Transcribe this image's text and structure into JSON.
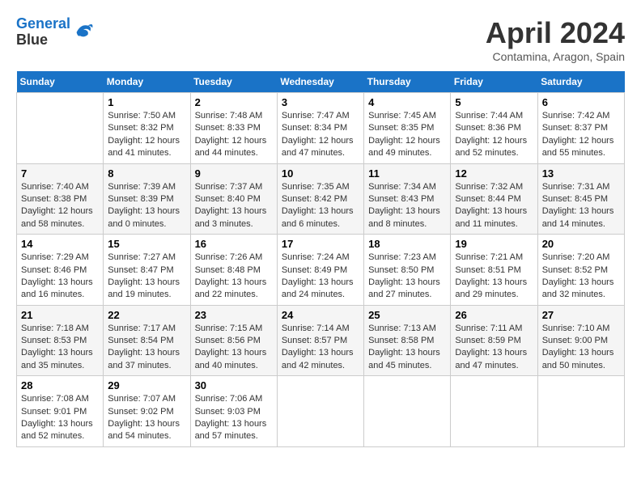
{
  "logo": {
    "line1": "General",
    "line2": "Blue"
  },
  "title": "April 2024",
  "location": "Contamina, Aragon, Spain",
  "days_of_week": [
    "Sunday",
    "Monday",
    "Tuesday",
    "Wednesday",
    "Thursday",
    "Friday",
    "Saturday"
  ],
  "weeks": [
    [
      {
        "day": "",
        "sunrise": "",
        "sunset": "",
        "daylight": ""
      },
      {
        "day": "1",
        "sunrise": "Sunrise: 7:50 AM",
        "sunset": "Sunset: 8:32 PM",
        "daylight": "Daylight: 12 hours and 41 minutes."
      },
      {
        "day": "2",
        "sunrise": "Sunrise: 7:48 AM",
        "sunset": "Sunset: 8:33 PM",
        "daylight": "Daylight: 12 hours and 44 minutes."
      },
      {
        "day": "3",
        "sunrise": "Sunrise: 7:47 AM",
        "sunset": "Sunset: 8:34 PM",
        "daylight": "Daylight: 12 hours and 47 minutes."
      },
      {
        "day": "4",
        "sunrise": "Sunrise: 7:45 AM",
        "sunset": "Sunset: 8:35 PM",
        "daylight": "Daylight: 12 hours and 49 minutes."
      },
      {
        "day": "5",
        "sunrise": "Sunrise: 7:44 AM",
        "sunset": "Sunset: 8:36 PM",
        "daylight": "Daylight: 12 hours and 52 minutes."
      },
      {
        "day": "6",
        "sunrise": "Sunrise: 7:42 AM",
        "sunset": "Sunset: 8:37 PM",
        "daylight": "Daylight: 12 hours and 55 minutes."
      }
    ],
    [
      {
        "day": "7",
        "sunrise": "Sunrise: 7:40 AM",
        "sunset": "Sunset: 8:38 PM",
        "daylight": "Daylight: 12 hours and 58 minutes."
      },
      {
        "day": "8",
        "sunrise": "Sunrise: 7:39 AM",
        "sunset": "Sunset: 8:39 PM",
        "daylight": "Daylight: 13 hours and 0 minutes."
      },
      {
        "day": "9",
        "sunrise": "Sunrise: 7:37 AM",
        "sunset": "Sunset: 8:40 PM",
        "daylight": "Daylight: 13 hours and 3 minutes."
      },
      {
        "day": "10",
        "sunrise": "Sunrise: 7:35 AM",
        "sunset": "Sunset: 8:42 PM",
        "daylight": "Daylight: 13 hours and 6 minutes."
      },
      {
        "day": "11",
        "sunrise": "Sunrise: 7:34 AM",
        "sunset": "Sunset: 8:43 PM",
        "daylight": "Daylight: 13 hours and 8 minutes."
      },
      {
        "day": "12",
        "sunrise": "Sunrise: 7:32 AM",
        "sunset": "Sunset: 8:44 PM",
        "daylight": "Daylight: 13 hours and 11 minutes."
      },
      {
        "day": "13",
        "sunrise": "Sunrise: 7:31 AM",
        "sunset": "Sunset: 8:45 PM",
        "daylight": "Daylight: 13 hours and 14 minutes."
      }
    ],
    [
      {
        "day": "14",
        "sunrise": "Sunrise: 7:29 AM",
        "sunset": "Sunset: 8:46 PM",
        "daylight": "Daylight: 13 hours and 16 minutes."
      },
      {
        "day": "15",
        "sunrise": "Sunrise: 7:27 AM",
        "sunset": "Sunset: 8:47 PM",
        "daylight": "Daylight: 13 hours and 19 minutes."
      },
      {
        "day": "16",
        "sunrise": "Sunrise: 7:26 AM",
        "sunset": "Sunset: 8:48 PM",
        "daylight": "Daylight: 13 hours and 22 minutes."
      },
      {
        "day": "17",
        "sunrise": "Sunrise: 7:24 AM",
        "sunset": "Sunset: 8:49 PM",
        "daylight": "Daylight: 13 hours and 24 minutes."
      },
      {
        "day": "18",
        "sunrise": "Sunrise: 7:23 AM",
        "sunset": "Sunset: 8:50 PM",
        "daylight": "Daylight: 13 hours and 27 minutes."
      },
      {
        "day": "19",
        "sunrise": "Sunrise: 7:21 AM",
        "sunset": "Sunset: 8:51 PM",
        "daylight": "Daylight: 13 hours and 29 minutes."
      },
      {
        "day": "20",
        "sunrise": "Sunrise: 7:20 AM",
        "sunset": "Sunset: 8:52 PM",
        "daylight": "Daylight: 13 hours and 32 minutes."
      }
    ],
    [
      {
        "day": "21",
        "sunrise": "Sunrise: 7:18 AM",
        "sunset": "Sunset: 8:53 PM",
        "daylight": "Daylight: 13 hours and 35 minutes."
      },
      {
        "day": "22",
        "sunrise": "Sunrise: 7:17 AM",
        "sunset": "Sunset: 8:54 PM",
        "daylight": "Daylight: 13 hours and 37 minutes."
      },
      {
        "day": "23",
        "sunrise": "Sunrise: 7:15 AM",
        "sunset": "Sunset: 8:56 PM",
        "daylight": "Daylight: 13 hours and 40 minutes."
      },
      {
        "day": "24",
        "sunrise": "Sunrise: 7:14 AM",
        "sunset": "Sunset: 8:57 PM",
        "daylight": "Daylight: 13 hours and 42 minutes."
      },
      {
        "day": "25",
        "sunrise": "Sunrise: 7:13 AM",
        "sunset": "Sunset: 8:58 PM",
        "daylight": "Daylight: 13 hours and 45 minutes."
      },
      {
        "day": "26",
        "sunrise": "Sunrise: 7:11 AM",
        "sunset": "Sunset: 8:59 PM",
        "daylight": "Daylight: 13 hours and 47 minutes."
      },
      {
        "day": "27",
        "sunrise": "Sunrise: 7:10 AM",
        "sunset": "Sunset: 9:00 PM",
        "daylight": "Daylight: 13 hours and 50 minutes."
      }
    ],
    [
      {
        "day": "28",
        "sunrise": "Sunrise: 7:08 AM",
        "sunset": "Sunset: 9:01 PM",
        "daylight": "Daylight: 13 hours and 52 minutes."
      },
      {
        "day": "29",
        "sunrise": "Sunrise: 7:07 AM",
        "sunset": "Sunset: 9:02 PM",
        "daylight": "Daylight: 13 hours and 54 minutes."
      },
      {
        "day": "30",
        "sunrise": "Sunrise: 7:06 AM",
        "sunset": "Sunset: 9:03 PM",
        "daylight": "Daylight: 13 hours and 57 minutes."
      },
      {
        "day": "",
        "sunrise": "",
        "sunset": "",
        "daylight": ""
      },
      {
        "day": "",
        "sunrise": "",
        "sunset": "",
        "daylight": ""
      },
      {
        "day": "",
        "sunrise": "",
        "sunset": "",
        "daylight": ""
      },
      {
        "day": "",
        "sunrise": "",
        "sunset": "",
        "daylight": ""
      }
    ]
  ]
}
